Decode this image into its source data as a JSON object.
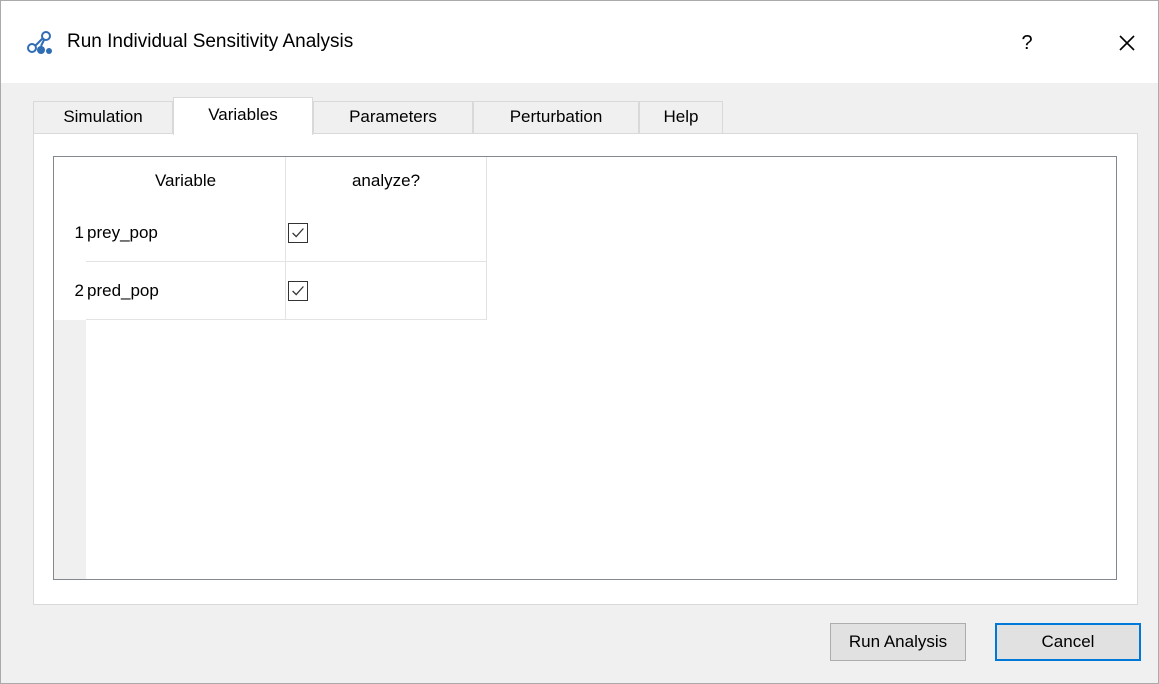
{
  "window": {
    "title": "Run Individual Sensitivity Analysis",
    "help_label": "?",
    "icon": "network-nodes-icon",
    "close_icon": "close-icon"
  },
  "tabs": [
    {
      "label": "Simulation",
      "active": false
    },
    {
      "label": "Variables",
      "active": true
    },
    {
      "label": "Parameters",
      "active": false
    },
    {
      "label": "Perturbation",
      "active": false
    },
    {
      "label": "Help",
      "active": false
    }
  ],
  "table": {
    "columns": [
      "Variable",
      "analyze?"
    ],
    "rows": [
      {
        "num": "1",
        "variable": "prey_pop",
        "analyze": true
      },
      {
        "num": "2",
        "variable": "pred_pop",
        "analyze": true
      }
    ]
  },
  "buttons": {
    "run": "Run Analysis",
    "cancel": "Cancel"
  },
  "colors": {
    "accent": "#0078d7",
    "window_bg": "#f0f0f0",
    "icon_blue": "#2f6db5"
  }
}
